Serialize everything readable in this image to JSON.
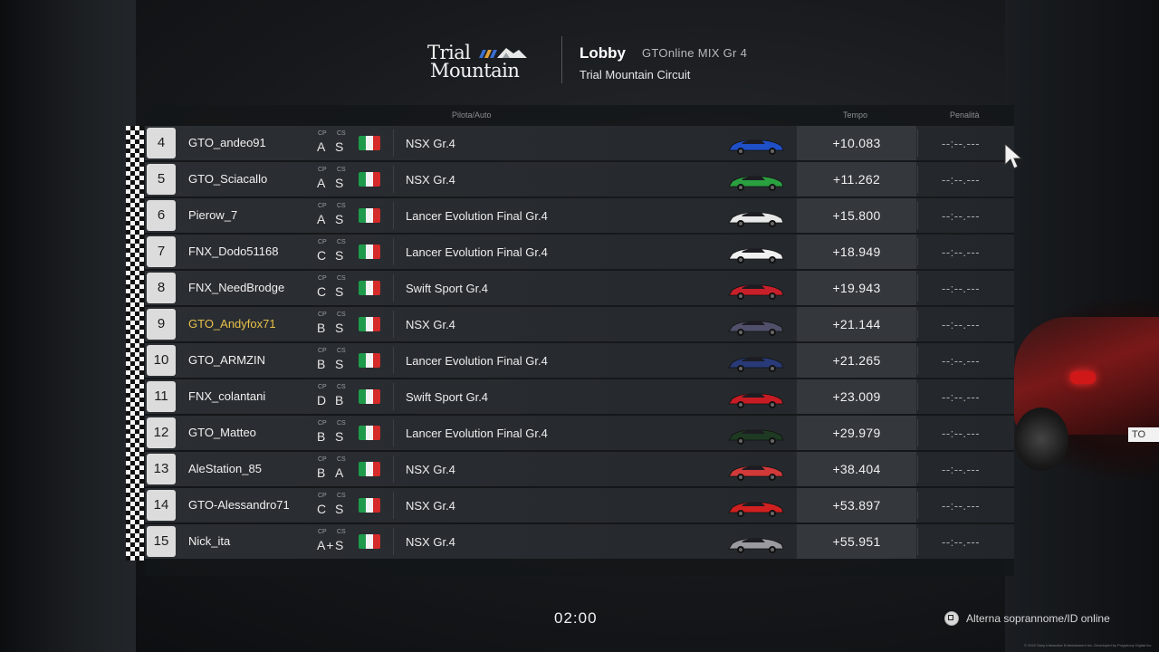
{
  "header": {
    "logo_line1": "Trial",
    "logo_line2": "Mountain",
    "title": "Lobby",
    "mode": "GTOnline MIX Gr 4",
    "track": "Trial Mountain Circuit"
  },
  "table": {
    "col_driver_car": "Pilota/Auto",
    "col_time": "Tempo",
    "col_penalty": "Penalità",
    "cp_label": "CP",
    "cs_label": "CS",
    "rows": [
      {
        "pos": "4",
        "name": "GTO_andeo91",
        "cp": "A",
        "cs": "S",
        "car": "NSX Gr.4",
        "time": "+10.083",
        "penalty": "--:--.---",
        "car_color": "#2050c8",
        "highlight": false
      },
      {
        "pos": "5",
        "name": "GTO_Sciacallo",
        "cp": "A",
        "cs": "S",
        "car": "NSX Gr.4",
        "time": "+11.262",
        "penalty": "--:--.---",
        "car_color": "#2aa040",
        "highlight": false
      },
      {
        "pos": "6",
        "name": "Pierow_7",
        "cp": "A",
        "cs": "S",
        "car": "Lancer Evolution Final Gr.4",
        "time": "+15.800",
        "penalty": "--:--.---",
        "car_color": "#e8e8e8",
        "highlight": false
      },
      {
        "pos": "7",
        "name": "FNX_Dodo51168",
        "cp": "C",
        "cs": "S",
        "car": "Lancer Evolution Final Gr.4",
        "time": "+18.949",
        "penalty": "--:--.---",
        "car_color": "#f0f0f0",
        "highlight": false
      },
      {
        "pos": "8",
        "name": "FNX_NeedBrodge",
        "cp": "C",
        "cs": "S",
        "car": "Swift Sport Gr.4",
        "time": "+19.943",
        "penalty": "--:--.---",
        "car_color": "#c8202a",
        "highlight": false
      },
      {
        "pos": "9",
        "name": "GTO_Andyfox71",
        "cp": "B",
        "cs": "S",
        "car": "NSX Gr.4",
        "time": "+21.144",
        "penalty": "--:--.---",
        "car_color": "#50506a",
        "highlight": true
      },
      {
        "pos": "10",
        "name": "GTO_ARMZIN",
        "cp": "B",
        "cs": "S",
        "car": "Lancer Evolution Final Gr.4",
        "time": "+21.265",
        "penalty": "--:--.---",
        "car_color": "#283a78",
        "highlight": false
      },
      {
        "pos": "11",
        "name": "FNX_colantani",
        "cp": "D",
        "cs": "B",
        "car": "Swift Sport Gr.4",
        "time": "+23.009",
        "penalty": "--:--.---",
        "car_color": "#c81c24",
        "highlight": false
      },
      {
        "pos": "12",
        "name": "GTO_Matteo",
        "cp": "B",
        "cs": "S",
        "car": "Lancer Evolution Final Gr.4",
        "time": "+29.979",
        "penalty": "--:--.---",
        "car_color": "#1e3a22",
        "highlight": false
      },
      {
        "pos": "13",
        "name": "AleStation_85",
        "cp": "B",
        "cs": "A",
        "car": "NSX Gr.4",
        "time": "+38.404",
        "penalty": "--:--.---",
        "car_color": "#d23a3a",
        "highlight": false
      },
      {
        "pos": "14",
        "name": "GTO-Alessandro71",
        "cp": "C",
        "cs": "S",
        "car": "NSX Gr.4",
        "time": "+53.897",
        "penalty": "--:--.---",
        "car_color": "#d02020",
        "highlight": false
      },
      {
        "pos": "15",
        "name": "Nick_ita",
        "cp": "A+",
        "cs": "S",
        "car": "NSX Gr.4",
        "time": "+55.951",
        "penalty": "--:--.---",
        "car_color": "#9a9aa0",
        "highlight": false
      }
    ]
  },
  "footer": {
    "timer": "02:00",
    "toggle_button_icon": "square-button-icon",
    "toggle_label": "Alterna soprannome/ID online",
    "copyright": "© 2022 Sony Interactive Entertainment Inc. Developed by Polyphony Digital Inc."
  },
  "colors": {
    "highlight_name": "#e8c04a",
    "flag_green": "#1e9a4a",
    "flag_white": "#f2f2f2",
    "flag_red": "#d42a2a"
  }
}
